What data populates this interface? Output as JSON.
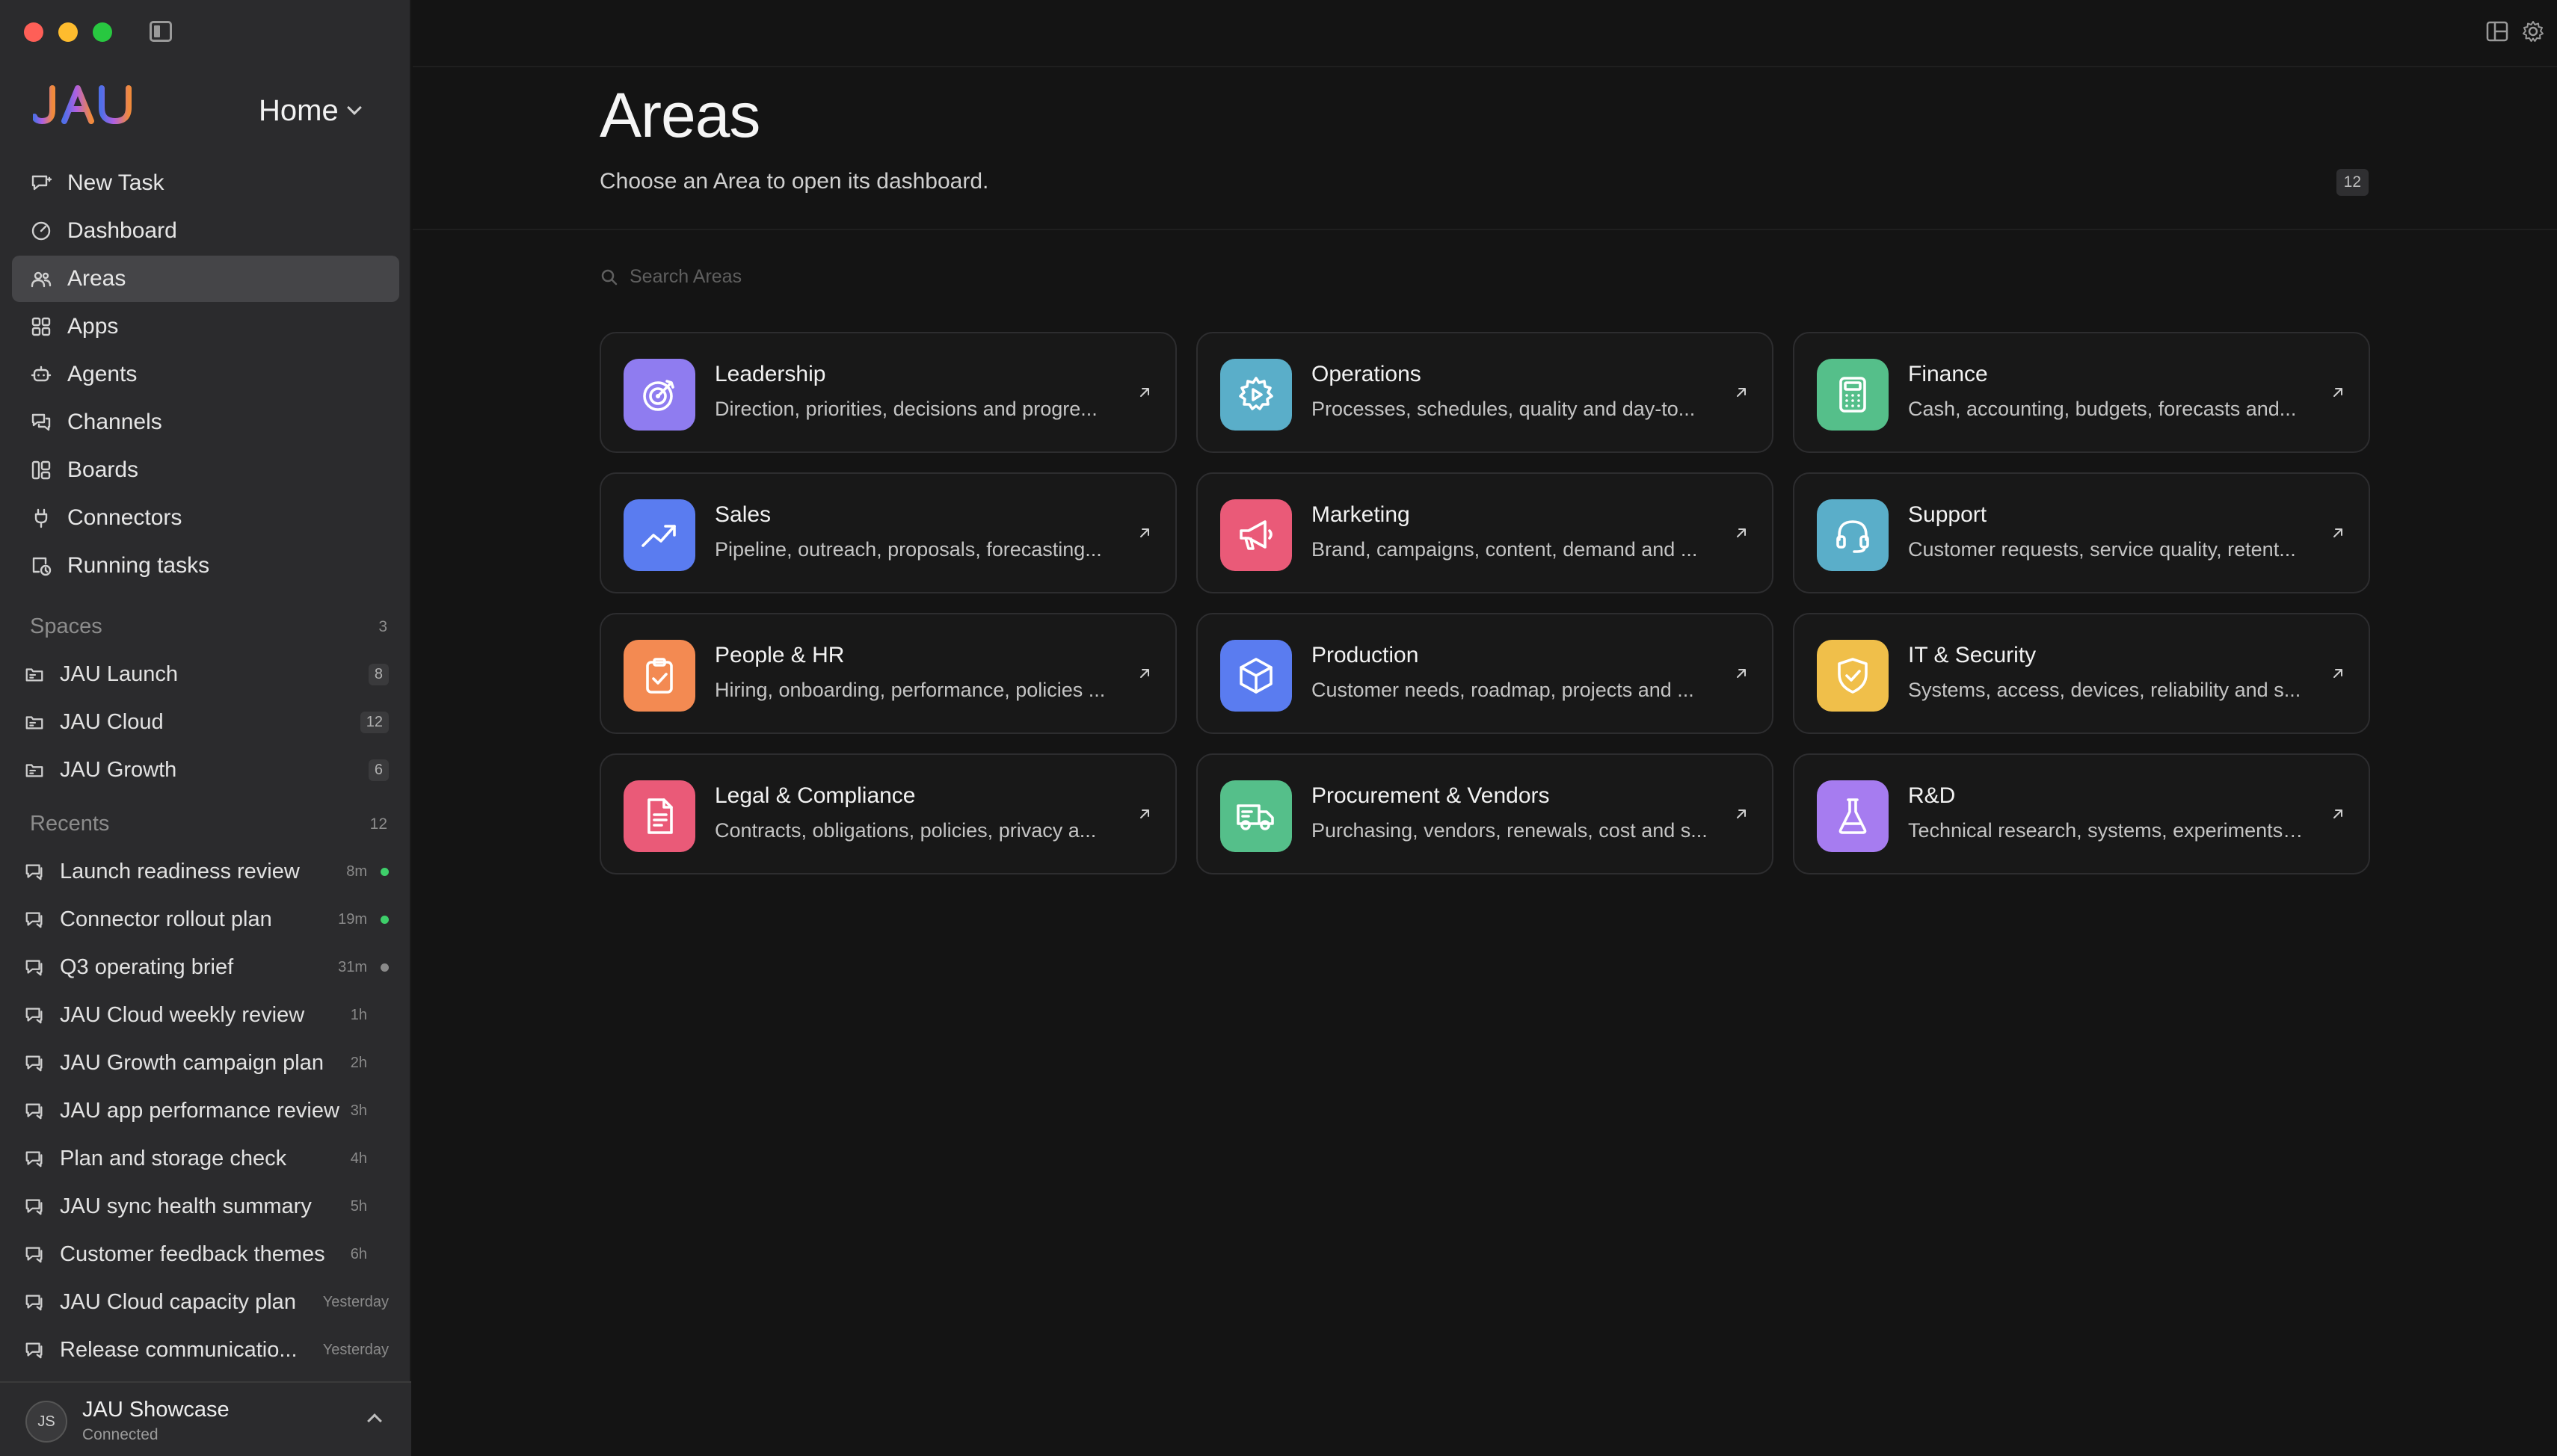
{
  "sidebar": {
    "logo": "JAU",
    "home_label": "Home",
    "nav": [
      {
        "label": "New Task",
        "icon": "chat-plus-icon"
      },
      {
        "label": "Dashboard",
        "icon": "gauge-icon"
      },
      {
        "label": "Areas",
        "icon": "people-icon",
        "active": true
      },
      {
        "label": "Apps",
        "icon": "apps-grid-icon"
      },
      {
        "label": "Agents",
        "icon": "bot-icon"
      },
      {
        "label": "Channels",
        "icon": "chat-bubbles-icon"
      },
      {
        "label": "Boards",
        "icon": "board-icon"
      },
      {
        "label": "Connectors",
        "icon": "plug-icon"
      },
      {
        "label": "Running tasks",
        "icon": "task-running-icon"
      }
    ],
    "spaces": {
      "title": "Spaces",
      "count": "3",
      "items": [
        {
          "label": "JAU Launch",
          "count": "8"
        },
        {
          "label": "JAU Cloud",
          "count": "12"
        },
        {
          "label": "JAU Growth",
          "count": "6"
        }
      ]
    },
    "recents": {
      "title": "Recents",
      "count": "12",
      "items": [
        {
          "label": "Launch readiness review",
          "time": "8m",
          "status": "green"
        },
        {
          "label": "Connector rollout plan",
          "time": "19m",
          "status": "green"
        },
        {
          "label": "Q3 operating brief",
          "time": "31m",
          "status": "gray"
        },
        {
          "label": "JAU Cloud weekly review",
          "time": "1h",
          "status": "none"
        },
        {
          "label": "JAU Growth campaign plan",
          "time": "2h",
          "status": "none"
        },
        {
          "label": "JAU app performance review",
          "time": "3h",
          "status": "none"
        },
        {
          "label": "Plan and storage check",
          "time": "4h",
          "status": "none"
        },
        {
          "label": "JAU sync health summary",
          "time": "5h",
          "status": "none"
        },
        {
          "label": "Customer feedback themes",
          "time": "6h",
          "status": "none"
        },
        {
          "label": "JAU Cloud capacity plan",
          "time": "Yesterday",
          "status": "none"
        },
        {
          "label": "Release communicatio...",
          "time": "Yesterday",
          "status": "none"
        }
      ]
    },
    "user": {
      "initials": "JS",
      "name": "JAU Showcase",
      "status": "Connected"
    }
  },
  "header": {
    "title": "Areas",
    "subtitle": "Choose an Area to open its dashboard.",
    "total_count": "12"
  },
  "search": {
    "placeholder": "Search Areas"
  },
  "areas": [
    {
      "title": "Leadership",
      "desc": "Direction, priorities, decisions and progre...",
      "icon": "target-icon",
      "color": "#8f7cf0"
    },
    {
      "title": "Operations",
      "desc": "Processes, schedules, quality and day-to...",
      "icon": "gear-play-icon",
      "color": "#5aaec9"
    },
    {
      "title": "Finance",
      "desc": "Cash, accounting, budgets, forecasts and...",
      "icon": "calculator-icon",
      "color": "#55bf8a"
    },
    {
      "title": "Sales",
      "desc": "Pipeline, outreach, proposals, forecasting...",
      "icon": "trend-up-icon",
      "color": "#5a7cf0"
    },
    {
      "title": "Marketing",
      "desc": "Brand, campaigns, content, demand and ...",
      "icon": "megaphone-icon",
      "color": "#ea5a78"
    },
    {
      "title": "Support",
      "desc": "Customer requests, service quality, retent...",
      "icon": "headset-icon",
      "color": "#5aaec9"
    },
    {
      "title": "People & HR",
      "desc": "Hiring, onboarding, performance, policies ...",
      "icon": "clipboard-check-icon",
      "color": "#f38a52"
    },
    {
      "title": "Production",
      "desc": "Customer needs, roadmap, projects and ...",
      "icon": "cube-icon",
      "color": "#5a7cf0"
    },
    {
      "title": "IT & Security",
      "desc": "Systems, access, devices, reliability and s...",
      "icon": "shield-check-icon",
      "color": "#f0bf4a"
    },
    {
      "title": "Legal & Compliance",
      "desc": "Contracts, obligations, policies, privacy a...",
      "icon": "document-icon",
      "color": "#ea5a78"
    },
    {
      "title": "Procurement & Vendors",
      "desc": "Purchasing, vendors, renewals, cost and s...",
      "icon": "truck-icon",
      "color": "#55bf8a"
    },
    {
      "title": "R&D",
      "desc": "Technical research, systems, experiments ...",
      "icon": "flask-icon",
      "color": "#a67cf0"
    }
  ],
  "colors": {
    "accent_green": "#3ecf6a",
    "status_gray": "#8a8a8a"
  }
}
